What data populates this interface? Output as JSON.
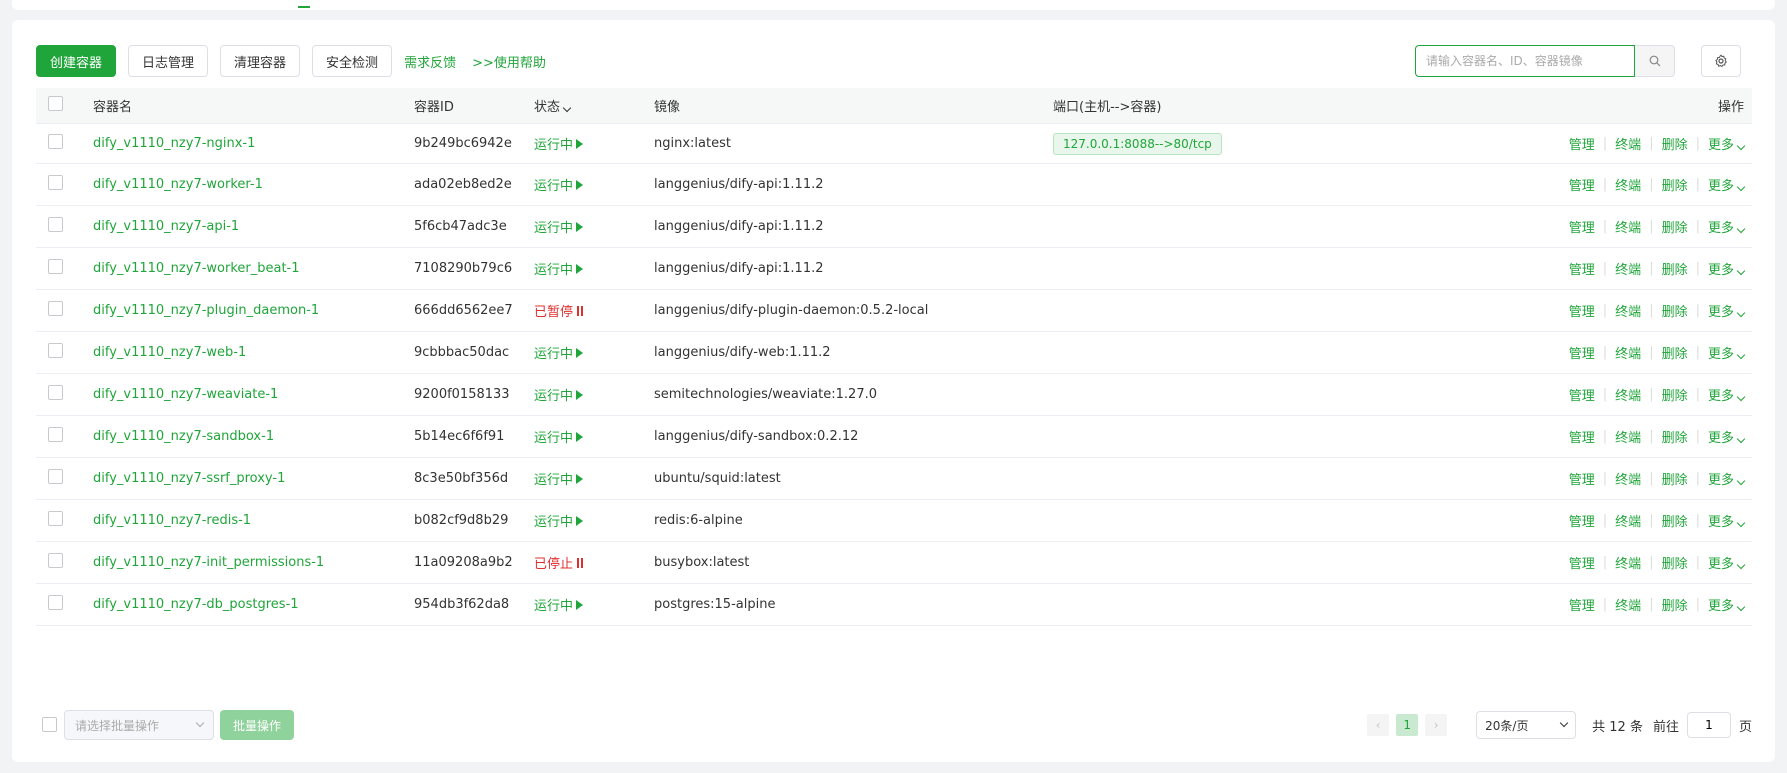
{
  "toolbar": {
    "create_label": "创建容器",
    "logs_label": "日志管理",
    "clean_label": "清理容器",
    "security_label": "安全检测",
    "feedback_label": "需求反馈",
    "help_label": ">>使用帮助"
  },
  "search": {
    "placeholder": "请输入容器名、ID、容器镜像"
  },
  "table": {
    "headers": {
      "name": "容器名",
      "id": "容器ID",
      "status": "状态",
      "image": "镜像",
      "port": "端口(主机-->容器)",
      "ops": "操作"
    },
    "ops": {
      "manage": "管理",
      "terminal": "终端",
      "delete": "删除",
      "more": "更多"
    },
    "rows": [
      {
        "name": "dify_v1110_nzy7-nginx-1",
        "id": "9b249bc6942e",
        "status": "运行中",
        "image": "nginx:latest",
        "port": "127.0.0.1:8088-->80/tcp"
      },
      {
        "name": "dify_v1110_nzy7-worker-1",
        "id": "ada02eb8ed2e",
        "status": "运行中",
        "image": "langgenius/dify-api:1.11.2",
        "port": ""
      },
      {
        "name": "dify_v1110_nzy7-api-1",
        "id": "5f6cb47adc3e",
        "status": "运行中",
        "image": "langgenius/dify-api:1.11.2",
        "port": ""
      },
      {
        "name": "dify_v1110_nzy7-worker_beat-1",
        "id": "7108290b79c6",
        "status": "运行中",
        "image": "langgenius/dify-api:1.11.2",
        "port": ""
      },
      {
        "name": "dify_v1110_nzy7-plugin_daemon-1",
        "id": "666dd6562ee7",
        "status": "已暂停",
        "image": "langgenius/dify-plugin-daemon:0.5.2-local",
        "port": ""
      },
      {
        "name": "dify_v1110_nzy7-web-1",
        "id": "9cbbbac50dac",
        "status": "运行中",
        "image": "langgenius/dify-web:1.11.2",
        "port": ""
      },
      {
        "name": "dify_v1110_nzy7-weaviate-1",
        "id": "9200f0158133",
        "status": "运行中",
        "image": "semitechnologies/weaviate:1.27.0",
        "port": ""
      },
      {
        "name": "dify_v1110_nzy7-sandbox-1",
        "id": "5b14ec6f6f91",
        "status": "运行中",
        "image": "langgenius/dify-sandbox:0.2.12",
        "port": ""
      },
      {
        "name": "dify_v1110_nzy7-ssrf_proxy-1",
        "id": "8c3e50bf356d",
        "status": "运行中",
        "image": "ubuntu/squid:latest",
        "port": ""
      },
      {
        "name": "dify_v1110_nzy7-redis-1",
        "id": "b082cf9d8b29",
        "status": "运行中",
        "image": "redis:6-alpine",
        "port": ""
      },
      {
        "name": "dify_v1110_nzy7-init_permissions-1",
        "id": "11a09208a9b2",
        "status": "已停止",
        "image": "busybox:latest",
        "port": ""
      },
      {
        "name": "dify_v1110_nzy7-db_postgres-1",
        "id": "954db3f62da8",
        "status": "运行中",
        "image": "postgres:15-alpine",
        "port": ""
      }
    ]
  },
  "footer": {
    "batch_placeholder": "请选择批量操作",
    "batch_button": "批量操作",
    "current_page": "1",
    "page_size": "20条/页",
    "total": "共 12 条",
    "goto_label": "前往",
    "goto_value": "1",
    "page_suffix": "页"
  },
  "colors": {
    "accent": "#20a53a",
    "stopped": "#e02f2f"
  }
}
